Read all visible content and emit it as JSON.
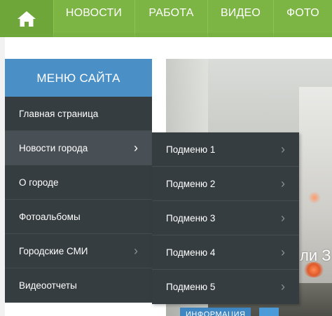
{
  "topnav": {
    "home_icon": "home-icon",
    "items": [
      "НОВОСТИ",
      "РАБОТА",
      "ВИДЕО",
      "ФОТО"
    ],
    "bg_color": "#7cb544"
  },
  "sidebar": {
    "title": "МЕНЮ САЙТА",
    "items": [
      {
        "label": "Главная страница"
      },
      {
        "label": "Новости города",
        "arrow": "›"
      },
      {
        "label": "О городе"
      },
      {
        "label": "Фотоальбомы"
      },
      {
        "label": "Городские СМИ",
        "arrow": "›"
      },
      {
        "label": "Видеоотчеты"
      }
    ],
    "active_index": 1
  },
  "submenu": {
    "items": [
      {
        "label": "Подменю 1",
        "arrow": "›"
      },
      {
        "label": "Подменю 2",
        "arrow": "›"
      },
      {
        "label": "Подменю 3",
        "arrow": "›"
      },
      {
        "label": "Подменю 4",
        "arrow": "›"
      },
      {
        "label": "Подменю 5",
        "arrow": "›"
      }
    ]
  },
  "feature": {
    "headline_fragment": "ли З",
    "badge_label": "ИНФОРМАЦИЯ"
  }
}
